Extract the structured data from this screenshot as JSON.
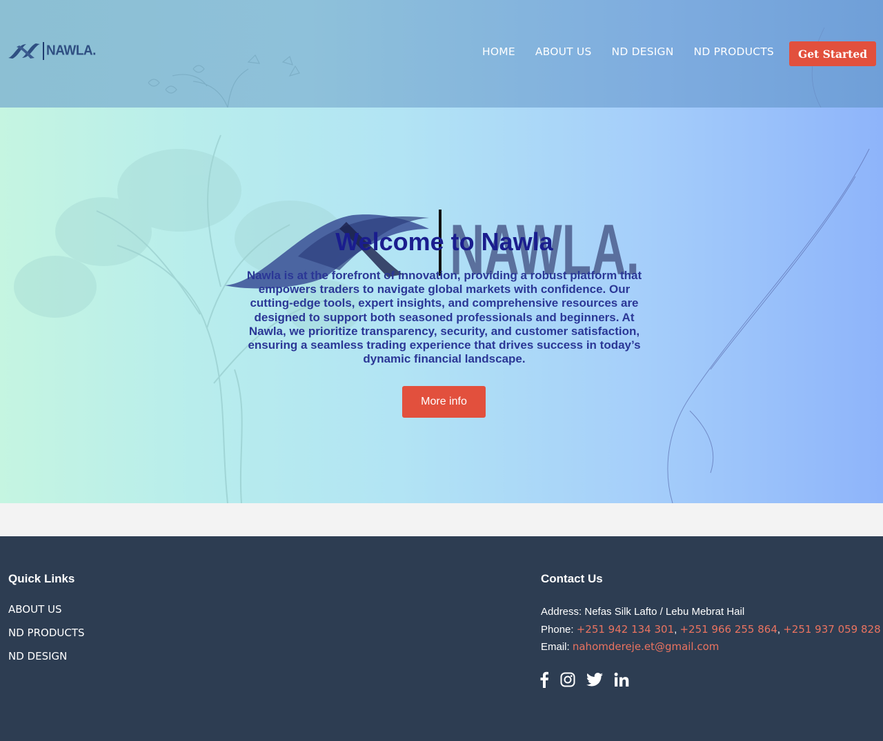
{
  "header": {
    "logo_text": "NAWLA.",
    "nav": [
      "HOME",
      "ABOUT US",
      "ND DESIGN",
      "ND PRODUCTS"
    ],
    "cta_label": "Get Started"
  },
  "hero": {
    "logo_text": "NAWLA.",
    "title": "Welcome to Nawla",
    "description": "Nawla is at the forefront of innovation, providing a robust platform that empowers traders to navigate global markets with confidence. Our cutting-edge tools, expert insights, and comprehensive resources are designed to support both seasoned professionals and beginners. At Nawla, we prioritize transparency, security, and customer satisfaction, ensuring a seamless trading experience that drives success in today’s dynamic financial landscape.",
    "button_label": "More info"
  },
  "footer": {
    "quick_links_heading": "Quick Links",
    "quick_links": [
      "ABOUT US",
      "ND PRODUCTS",
      "ND DESIGN"
    ],
    "contact_heading": "Contact Us",
    "address_label": "Address:",
    "address_value": "Nefas Silk Lafto / Lebu Mebrat Hail",
    "phone_label": "Phone:",
    "phones": [
      "+251 942 134 301",
      "+251 966 255 864",
      "+251 937 059 828"
    ],
    "email_label": "Email:",
    "email": "nahomdereje.et@gmail.com",
    "social_icons": [
      "facebook-icon",
      "instagram-icon",
      "twitter-icon",
      "linkedin-icon"
    ]
  },
  "colors": {
    "accent": "#e2503d",
    "footer_bg": "#2d3d52",
    "title_color": "#1a1d8e",
    "link_color": "#ea7360"
  }
}
